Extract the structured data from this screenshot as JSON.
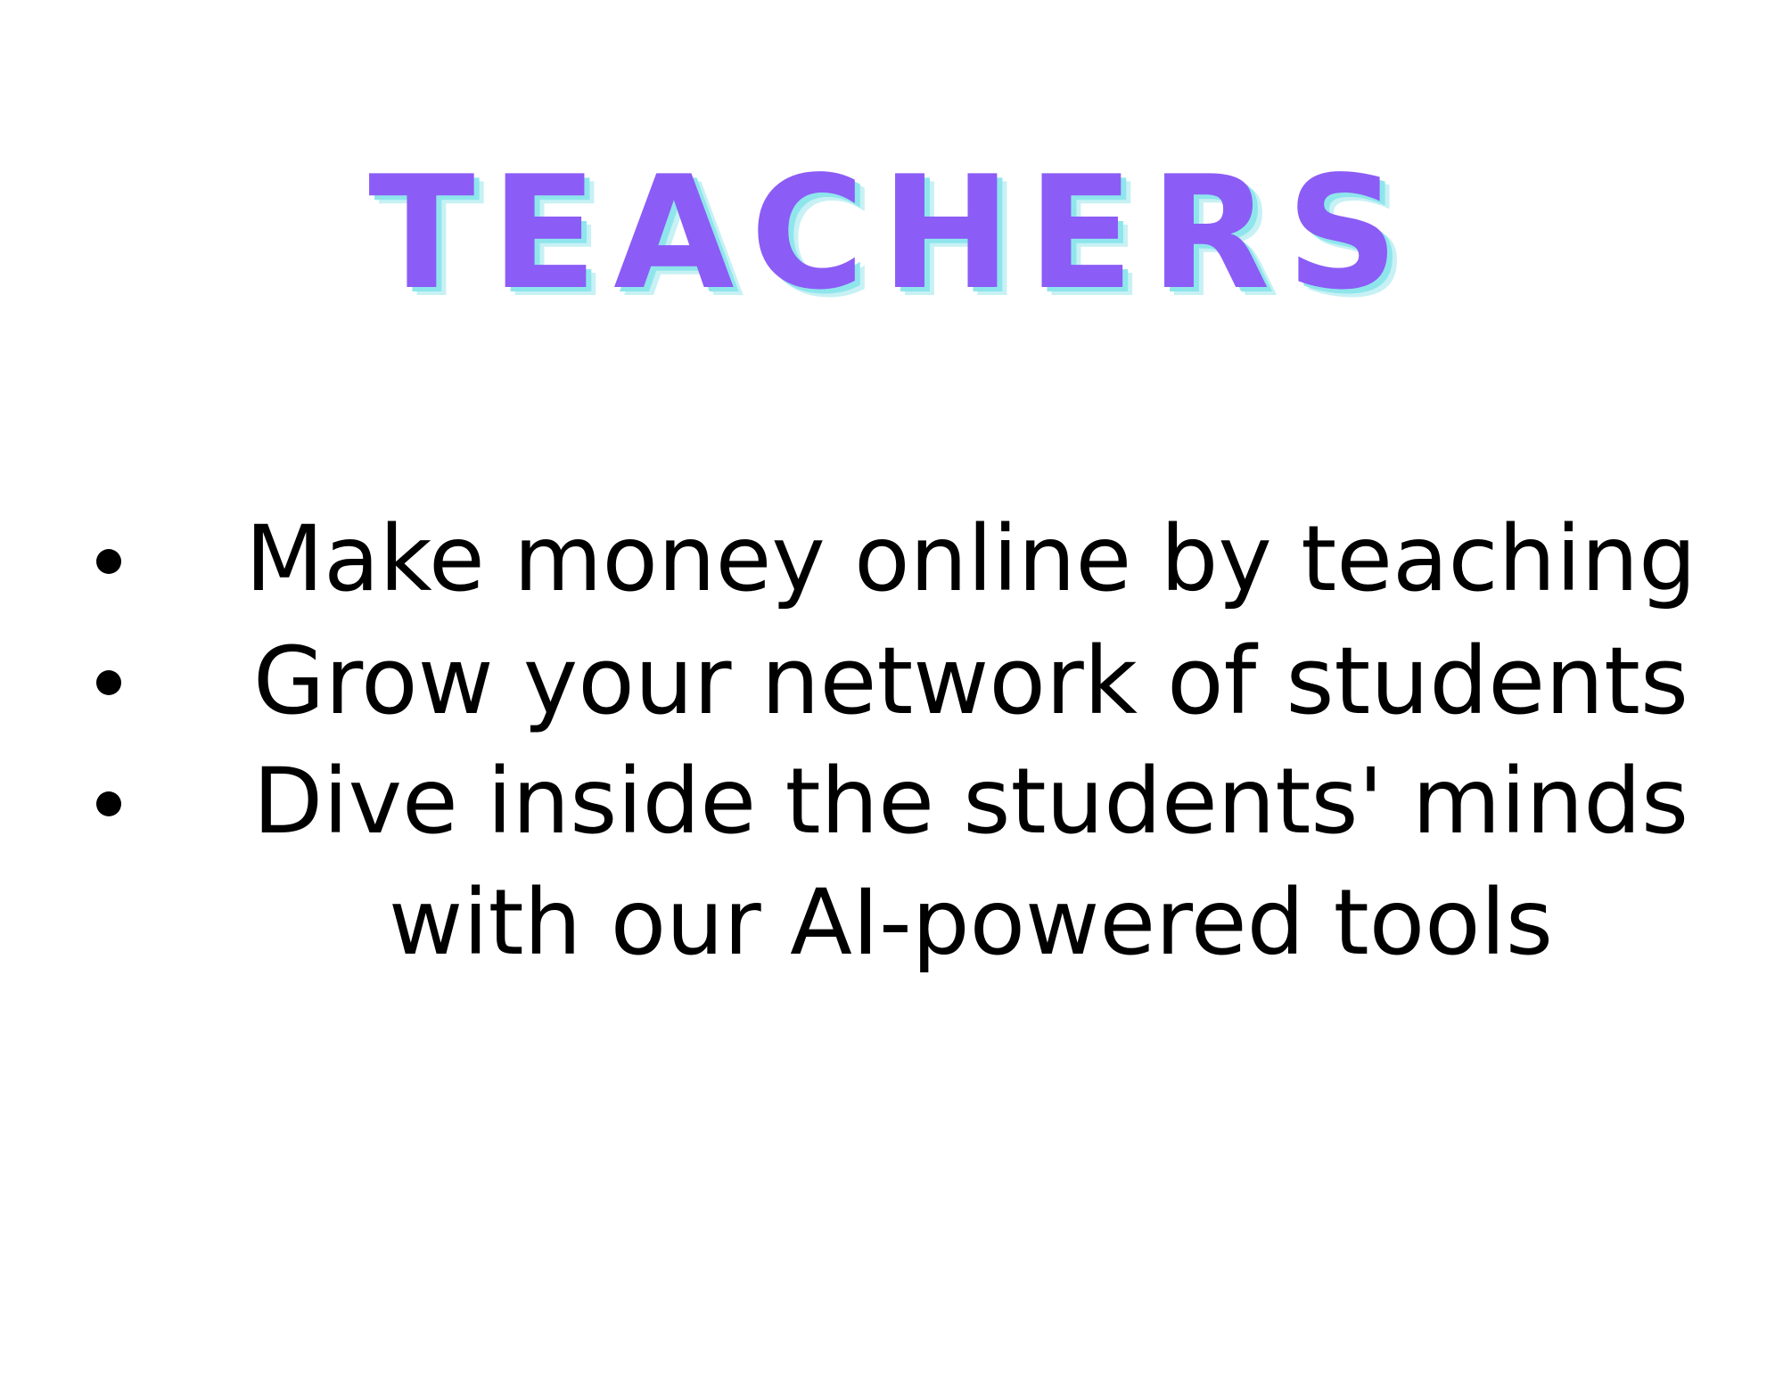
{
  "title": "TEACHERS",
  "colors": {
    "title": "#8b5cf6",
    "title_shadow": "#8ee6ec",
    "text": "#000000",
    "background": "#ffffff"
  },
  "bullets": [
    {
      "text": "Make money online by teaching"
    },
    {
      "text": "Grow your network of students"
    },
    {
      "text": "Dive inside the students' minds with our AI-powered tools"
    }
  ]
}
